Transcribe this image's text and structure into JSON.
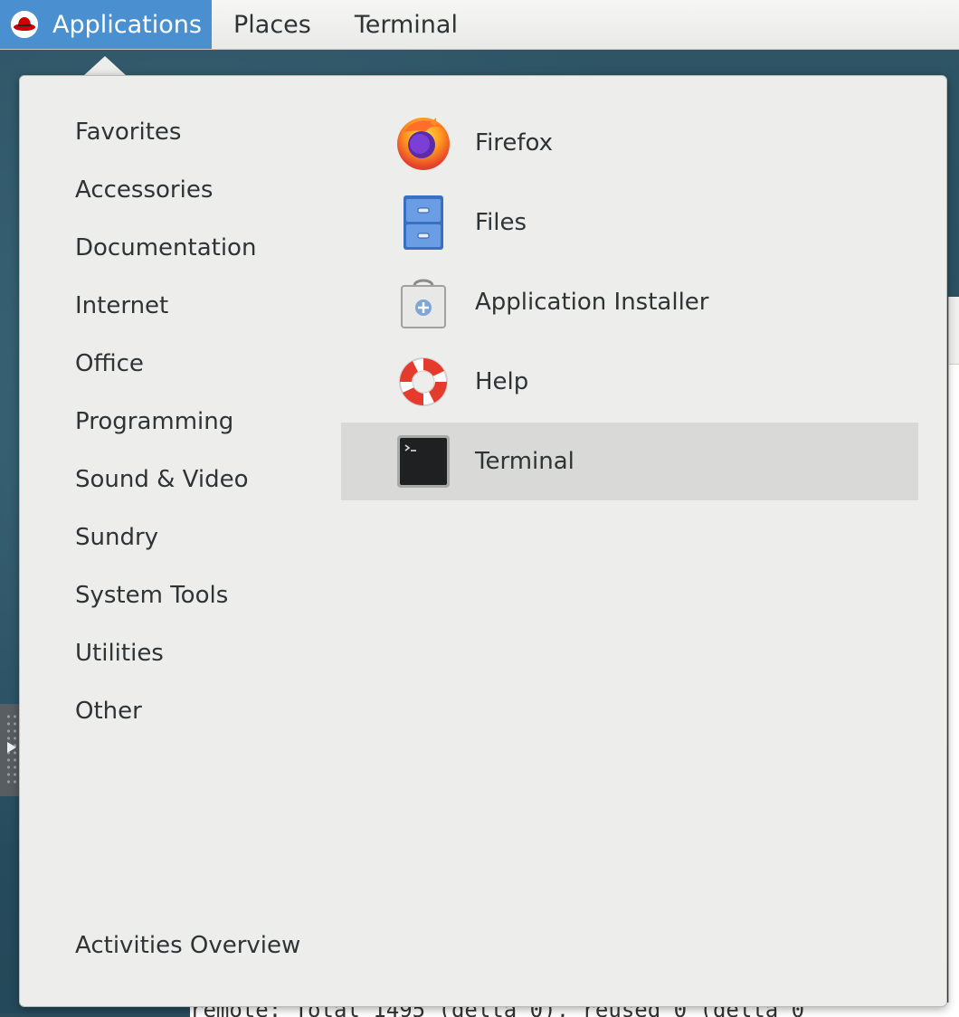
{
  "topbar": {
    "applications": "Applications",
    "places": "Places",
    "terminal": "Terminal"
  },
  "menu": {
    "categories": [
      "Favorites",
      "Accessories",
      "Documentation",
      "Internet",
      "Office",
      "Programming",
      "Sound & Video",
      "Sundry",
      "System Tools",
      "Utilities",
      "Other"
    ],
    "apps": [
      {
        "label": "Firefox",
        "icon": "firefox-icon"
      },
      {
        "label": "Files",
        "icon": "files-icon"
      },
      {
        "label": "Application Installer",
        "icon": "application-installer-icon"
      },
      {
        "label": "Help",
        "icon": "help-icon"
      },
      {
        "label": "Terminal",
        "icon": "terminal-icon",
        "selected": true
      }
    ],
    "activities_overview": "Activities Overview"
  },
  "background": {
    "terminal_line": "remote: Total 1495 (delta 0), reused 0 (delta 0"
  },
  "colors": {
    "accent": "#4a8fd0",
    "menu_bg": "#ededec",
    "selected_bg": "#d9dad8",
    "text": "#2e3436"
  }
}
